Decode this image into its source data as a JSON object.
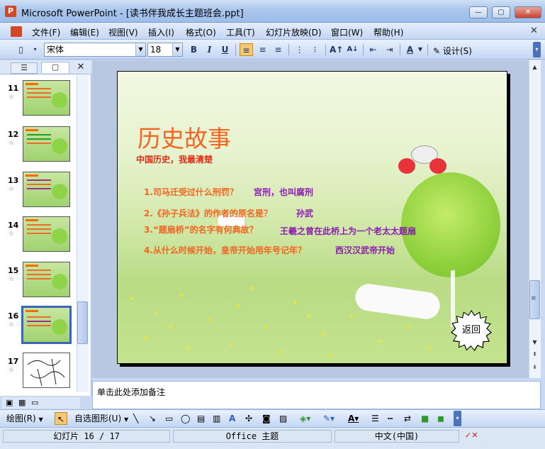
{
  "window": {
    "title": "Microsoft PowerPoint - [读书伴我成长主题班会.ppt]",
    "app_icon": "P",
    "minimize": "—",
    "maximize": "▢",
    "close": "✕"
  },
  "menu": {
    "items": [
      "文件(F)",
      "编辑(E)",
      "视图(V)",
      "插入(I)",
      "格式(O)",
      "工具(T)",
      "幻灯片放映(D)",
      "窗口(W)",
      "帮助(H)"
    ],
    "doc_close": "✕"
  },
  "toolbar": {
    "font_name": "宋体",
    "font_size": "18",
    "bold": "B",
    "italic": "I",
    "underline": "U",
    "design_label": "设计(S)"
  },
  "slides_panel": {
    "tab_outline": "☰",
    "tab_slides": "▢",
    "close": "✕",
    "slides": [
      {
        "number": "11",
        "star": "☆"
      },
      {
        "number": "12",
        "star": "☆"
      },
      {
        "number": "13",
        "star": "☆"
      },
      {
        "number": "14",
        "star": "☆"
      },
      {
        "number": "15",
        "star": "☆"
      },
      {
        "number": "16",
        "star": "☆",
        "selected": true
      },
      {
        "number": "17",
        "star": "☆"
      }
    ]
  },
  "slide": {
    "title": "历史故事",
    "subtitle": "中国历史，我最清楚",
    "qa": [
      {
        "q": "1.司马迁受过什么刑罚？",
        "a": "宫刑，也叫腐刑"
      },
      {
        "q": "2.《孙子兵法》的作者的原名是？",
        "a": "孙武"
      },
      {
        "q": "3.“题扇桥”的名字有何典故？",
        "a": "王羲之曾在此桥上为一个老太太题扇"
      },
      {
        "q": "4.从什么时候开始，皇帝开始用年号记年？",
        "a": "西汉汉武帝开始"
      }
    ],
    "return_button": "返回",
    "colors": {
      "title": "#f26522",
      "subtitle": "#e32a12",
      "answer": "#8b1fb0"
    }
  },
  "notes": {
    "placeholder": "单击此处添加备注"
  },
  "drawing_toolbar": {
    "draw": "绘图(R)",
    "autoshapes": "自选图形(U)"
  },
  "status": {
    "slide": "幻灯片 16 / 17",
    "theme": "Office 主题",
    "language": "中文(中国)"
  }
}
